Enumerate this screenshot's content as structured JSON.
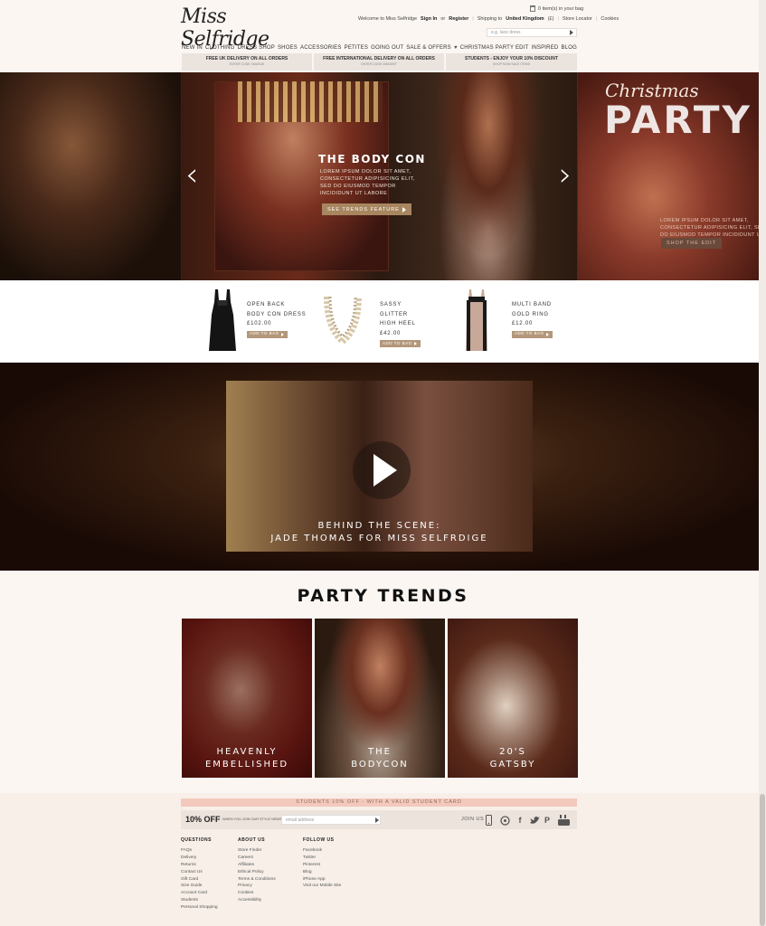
{
  "header": {
    "logo": "Miss Selfridge",
    "bag_text": "0 item(s) in your bag",
    "welcome": "Welcome to Miss Selfridge",
    "sign_in": "Sign In",
    "or": "or",
    "register": "Register",
    "shipping_prefix": "Shipping to",
    "shipping_country": "United Kingdom",
    "shipping_currency": "(£)",
    "store_locator": "Store Locator",
    "cookies": "Cookies",
    "search_placeholder": "e.g. lace dress"
  },
  "nav": [
    "NEW IN",
    "CLOTHING",
    "DRESS SHOP",
    "SHOES",
    "ACCESSORIES",
    "PETITES",
    "GOING OUT",
    "SALE & OFFERS",
    "♥",
    "CHRISTMAS PARTY EDIT",
    "INSPIRED",
    "BLOG"
  ],
  "promos": [
    {
      "title": "FREE UK DELIVERY ON ALL ORDERS",
      "sub": "ENTER CODE XMASUK"
    },
    {
      "title": "FREE INTERNATIONAL DELIVERY ON ALL ORDERS",
      "sub": "ENTER CODE XMASINT"
    },
    {
      "title": "STUDENTS - ENJOY YOUR 10% DISCOUNT",
      "sub": "SHOP NOW SALE ITEMS"
    }
  ],
  "hero": {
    "title": "THE BODY CON",
    "copy": "LOREM IPSUM DOLOR SIT AMET, CONSECTETUR ADIPISICING ELIT, SED DO EIUSMOD TEMPOR INCIDIDUNT UT LABORE",
    "cta": "SEE TRENDS FEATURE",
    "prev": "‹",
    "next": "›",
    "side_script": "Christmas",
    "side_title": "PARTY",
    "side_copy": "LOREM IPSUM DOLOR SIT AMET, CONSECTETUR ADIPISICING ELIT, SED DO EIUSMOD TEMPOR INCIDIDUNT UT",
    "side_cta": "SHOP THE EDIT"
  },
  "products": [
    {
      "line1": "OPEN BACK",
      "line2": "BODY CON DRESS",
      "price": "£102.00",
      "button": "ADD TO BAG"
    },
    {
      "line1": "SASSY GLITTER",
      "line2": "HIGH HEEL",
      "price": "£42.00",
      "button": "ADD TO BAG"
    },
    {
      "line1": "MULTI BAND",
      "line2": "GOLD RING",
      "price": "£12.00",
      "button": "ADD TO BAG"
    }
  ],
  "video": {
    "line1": "BEHIND THE SCENE:",
    "line2": "JADE THOMAS FOR MISS SELFRDIGE"
  },
  "trends": {
    "title": "PARTY TRENDS",
    "items": [
      {
        "line1": "HEAVENLY",
        "line2": "EMBELLISHED"
      },
      {
        "line1": "THE",
        "line2": "BODYCON"
      },
      {
        "line1": "20'S",
        "line2": "GATSBY"
      }
    ]
  },
  "footer": {
    "student_strip": "STUDENTS 10% OFF - WITH A VALID STUDENT CARD",
    "signup_pct": "10% OFF",
    "signup_text": "WHEN YOU JOIN OUR STYLE NEWS",
    "email_placeholder": "email address",
    "join_us": "JOIN US",
    "social_icons": [
      "mobile-icon",
      "blog-icon",
      "facebook-icon",
      "twitter-icon",
      "pinterest-icon",
      "youtube-icon"
    ],
    "col1": {
      "title": "QUESTIONS",
      "links": [
        "FAQs",
        "Delivery",
        "Returns",
        "Contact Us",
        "Gift Card",
        "Size Guide",
        "Account Card",
        "Students",
        "Personal Shopping"
      ]
    },
    "col2": {
      "title": "ABOUT US",
      "links": [
        "Store Finder",
        "Careers",
        "Affiliates",
        "Ethical Policy",
        "Terms & Conditions",
        "Privacy",
        "Cookies",
        "Accessibility"
      ]
    },
    "col3": {
      "title": "FOLLOW US",
      "links": [
        "Facebook",
        "Twitter",
        "Pinterest",
        "Blog",
        "iPhone App",
        "Visit our Mobile Site"
      ]
    }
  },
  "colors": {
    "accent": "#b3977a",
    "student_strip": "#f3c9bd",
    "background": "#fbf6f2"
  }
}
